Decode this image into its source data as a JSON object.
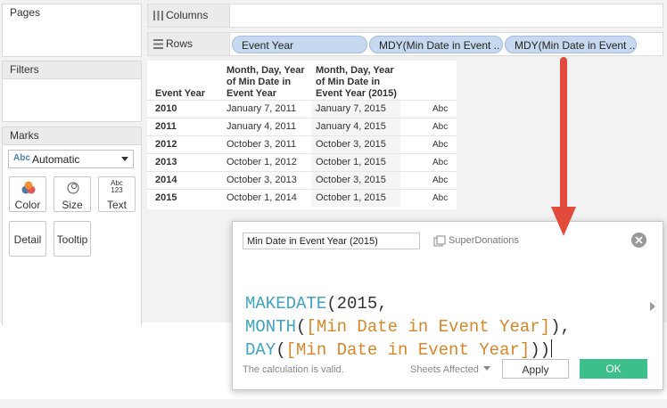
{
  "cards": {
    "pages": "Pages",
    "filters": "Filters",
    "marks": "Marks"
  },
  "shelves": {
    "columns_label": "Columns",
    "rows_label": "Rows",
    "row_pills": [
      "Event Year",
      "MDY(Min Date in Event ..",
      "MDY(Min Date in Event .."
    ]
  },
  "marks": {
    "mark_type_prefix": "Abc",
    "mark_type": "Automatic",
    "buttons": {
      "color": "Color",
      "size": "Size",
      "text": "Text",
      "detail": "Detail",
      "tooltip": "Tooltip"
    },
    "text_icon_line1": "Abc",
    "text_icon_line2": "123"
  },
  "table": {
    "headers": [
      "Event Year",
      "Month, Day, Year of Min Date in Event Year",
      "Month, Day, Year of Min Date in Event Year (2015)",
      ""
    ],
    "rows": [
      {
        "year": "2010",
        "min_date": "January 7, 2011",
        "min_date_2015": "January 7, 2015",
        "abc": "Abc"
      },
      {
        "year": "2011",
        "min_date": "January 4, 2011",
        "min_date_2015": "January 4, 2015",
        "abc": "Abc"
      },
      {
        "year": "2012",
        "min_date": "October 3, 2011",
        "min_date_2015": "October 3, 2015",
        "abc": "Abc"
      },
      {
        "year": "2013",
        "min_date": "October 1, 2012",
        "min_date_2015": "October 1, 2015",
        "abc": "Abc"
      },
      {
        "year": "2014",
        "min_date": "October 3, 2013",
        "min_date_2015": "October 3, 2015",
        "abc": "Abc"
      },
      {
        "year": "2015",
        "min_date": "October 1, 2014",
        "min_date_2015": "October 1, 2015",
        "abc": "Abc"
      }
    ]
  },
  "dialog": {
    "calc_name": "Min Date in Event Year (2015)",
    "datasource": "SuperDonations",
    "code": {
      "l1_fn": "MAKEDATE",
      "l1_rest": "(2015,",
      "l2_fn": "MONTH",
      "l2_open": "(",
      "l2_field": "[Min Date in Event Year]",
      "l2_close": "),",
      "l3_fn": "DAY",
      "l3_open": "(",
      "l3_field": "[Min Date in Event Year]",
      "l3_close": "))"
    },
    "status": "The calculation is valid.",
    "sheets_affected": "Sheets Affected",
    "apply": "Apply",
    "ok": "OK"
  },
  "colors": {
    "pill_bg": "#c6d9ef",
    "function": "#3fa3c2",
    "field": "#d8862a",
    "ok_button": "#3dbf8c",
    "arrow": "#e24a3b"
  }
}
